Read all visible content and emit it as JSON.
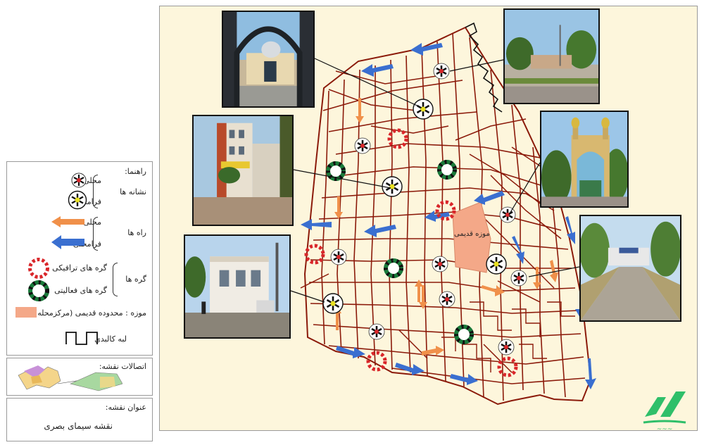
{
  "legend": {
    "title": "راهنما:",
    "landmarks_group": "نشانه ها",
    "landmark_local": "محلی",
    "landmark_regional": "فرامحلی",
    "roads_group": "راه ها",
    "road_local": "محلی",
    "road_regional": "فرامحلی",
    "nodes_group": "گره ها",
    "node_traffic": "گره های ترافیکی",
    "node_activity": "گره های فعالیتی",
    "museum_item": "موزه : محدوده قدیمی (مرکزمحله)",
    "edge_item": "لبه کالبدی"
  },
  "connections": {
    "title": "اتصالات نقشه:"
  },
  "map_title": {
    "label": "عنوان نقشه:",
    "value": "نقشه سیمای بصری"
  },
  "map": {
    "museum_label": "موزه قدیمی"
  },
  "colors": {
    "road": "#8b1a0a",
    "local_arrow": "#f0904a",
    "regional_arrow": "#3a6fd0",
    "museum": "#f4a888",
    "traffic_node": "#d9262a",
    "activity_node": "#1a7a3a",
    "background": "#fdf6dc"
  },
  "icons": [
    "landmark-local-icon",
    "landmark-regional-icon",
    "traffic-node-icon",
    "activity-node-icon",
    "local-road-arrow-icon",
    "regional-road-arrow-icon",
    "physical-edge-icon"
  ]
}
